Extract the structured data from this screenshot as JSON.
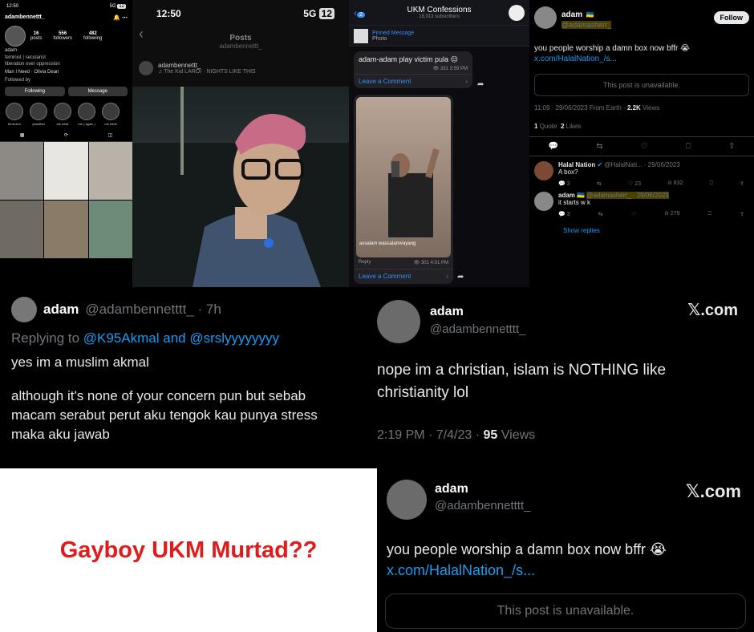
{
  "instagram": {
    "time": "12:50",
    "signal": "5G",
    "battery": "12",
    "username": "adambennettt_",
    "stats": [
      {
        "num": "16",
        "label": "posts"
      },
      {
        "num": "556",
        "label": "followers"
      },
      {
        "num": "482",
        "label": "following"
      }
    ],
    "display_name": "adam",
    "bio1": "feminist | secularist",
    "bio2": "liberation over oppression",
    "song": "Man I Need · Olivia Dean",
    "followed_by": "Followed by",
    "following_btn": "Following",
    "message_btn": "Message",
    "highlights": [
      "feminism",
      "yassified",
      "idk what",
      "me ( again )",
      "me kikiki"
    ]
  },
  "post": {
    "time": "12:50",
    "signal": "5G",
    "battery": "12",
    "title": "Posts",
    "subtitle": "adambennettt_",
    "author": "adambennettt_",
    "song": "The Kid LAROI · NIGHTS LIKE THIS"
  },
  "telegram": {
    "badge": "2",
    "title": "UKM Confessions",
    "subscribers": "18,913 subscribers",
    "pinned_label": "Pinned Message",
    "pinned_type": "Photo",
    "msg1": "adam-adam play victim pula 😔",
    "msg1_meta": "331 3:59 PM",
    "leave_comment": "Leave a Comment",
    "caption2": "assalam wassalam#ayang",
    "reply": "Reply",
    "msg2_meta": "301 4:01 PM"
  },
  "x_thread": {
    "name": "adam",
    "flag": "🇺🇦",
    "handle": "@adamasherr_",
    "follow": "Follow",
    "text": "you people worship a damn box now bffr 😭",
    "link": "x.com/HalalNation_/s...",
    "unavailable": "This post is unavailable.",
    "time": "11:09 · 29/06/2023 From Earth ·",
    "views_num": "2.2K",
    "views_label": "Views",
    "quotes_num": "1",
    "quotes_label": "Quote",
    "likes_num": "2",
    "likes_label": "Likes",
    "reply1": {
      "name": "Halal Nation",
      "handle": "@HalalNati... · 29/06/2023",
      "text": "A box?",
      "counts": [
        "3",
        "",
        "23",
        "832",
        ""
      ]
    },
    "reply2": {
      "name": "adam",
      "flag": "🇺🇦",
      "handle": "@adamasherr_ · 29/06/2023",
      "text": "it starts w k",
      "counts": [
        "3",
        "",
        "",
        "279",
        ""
      ]
    },
    "show_replies": "Show replies"
  },
  "tweet_left": {
    "name": "adam",
    "handle": "@adambennetttt_ · 7h",
    "replying_prefix": "Replying to",
    "replying_to": "@K95Akmal and @srslyyyyyyyy",
    "line1": "yes im a muslim akmal",
    "line2": "although it's none of your concern pun but sebab macam serabut perut aku tengok kau punya stress maka aku jawab"
  },
  "tweet_right": {
    "name": "adam",
    "handle": "@adambennetttt_",
    "xcom": "𝕏.com",
    "text": "nope im a christian, islam is NOTHING like christianity lol",
    "time": "2:19 PM · 7/4/23 ·",
    "views_num": "95",
    "views_label": "Views"
  },
  "caption": "Gayboy UKM Murtad??",
  "tweet_bottom": {
    "name": "adam",
    "handle": "@adambennetttt_",
    "xcom": "𝕏.com",
    "text": "you people worship a damn box now bffr 😭",
    "link": "x.com/HalalNation_/s...",
    "unavailable": "This post is unavailable."
  }
}
